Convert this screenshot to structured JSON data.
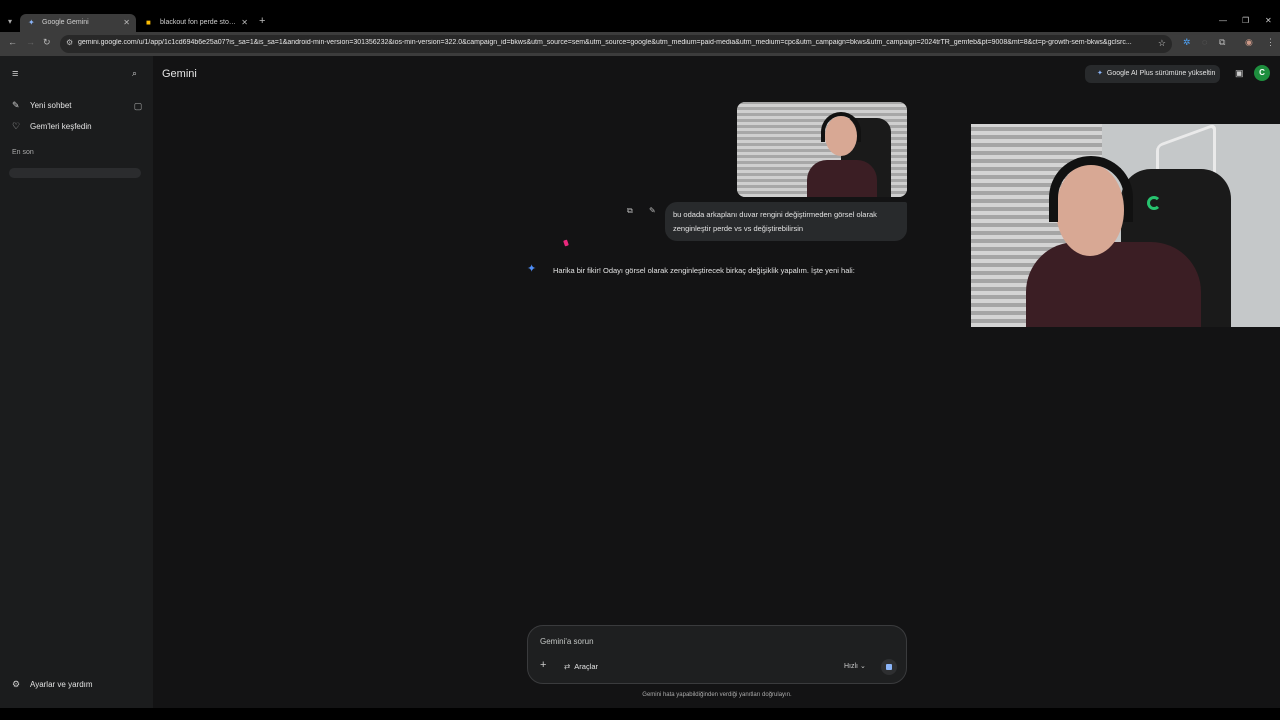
{
  "browser": {
    "tabs": [
      {
        "title": "Google Gemini",
        "active": true
      },
      {
        "title": "blackout fon perde store - Goo",
        "active": false
      }
    ],
    "url": "gemini.google.com/u/1/app/1c1cd694b6e25a07?is_sa=1&is_sa=1&android-min-version=301356232&ios-min-version=322.0&campaign_id=bkws&utm_source=sem&utm_source=google&utm_medium=paid-media&utm_medium=cpc&utm_campaign=bkws&utm_campaign=2024trTR_gemfeb&pt=9008&mt=8&ct=p-growth-sem-bkws&gclsrc..."
  },
  "app": {
    "brand": "Gemini",
    "upgrade_label": "Google AI Plus sürümüne yükseltin",
    "avatar_letter": "C",
    "accent_color": "#8ab4f8"
  },
  "sidebar": {
    "new_chat": "Yeni sohbet",
    "explore_gems": "Gem'leri keşfedin",
    "recent_heading": "En son",
    "settings": "Ayarlar ve yardım"
  },
  "chat": {
    "user_message": "bu odada arkaplanı duvar rengini değiştirmeden görsel olarak zenginleştir perde vs vs değiştirebilirsin",
    "model_reply": "Harika bir fikir! Odayı görsel olarak zenginleştirecek birkaç değişiklik yapalım. İşte yeni hali:"
  },
  "composer": {
    "placeholder": "Gemini'a sorun",
    "tools_label": "Araçlar",
    "mode_label": "Hızlı"
  },
  "footer": {
    "disclaimer": "Gemini hata yapabildiğinden verdiği yanıtları doğrulayın."
  }
}
